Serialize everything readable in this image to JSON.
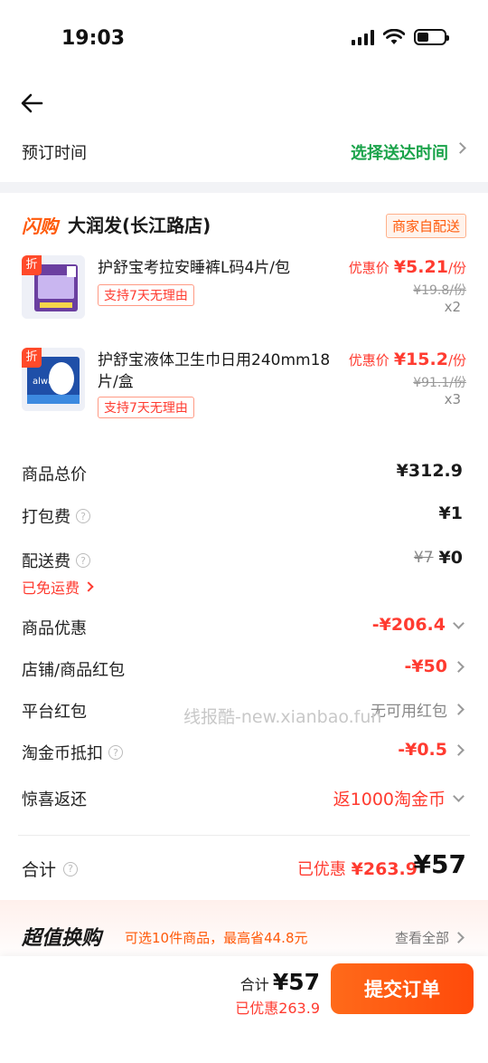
{
  "status_bar": {
    "time": "19:03"
  },
  "header": {
    "order_time_label": "预订时间",
    "order_time_value": "选择送达时间"
  },
  "store": {
    "logo_text": "闪购",
    "name": "大润发(长江路店)",
    "delivery_badge": "商家自配送"
  },
  "products": [
    {
      "discount_tag": "折",
      "name": "护舒宝考拉安睡裤L码4片/包",
      "return_tag": "支持7天无理由",
      "price_label": "优惠价",
      "price": "¥5.21",
      "unit": "/份",
      "original_price": "¥19.8/份",
      "quantity": "x2"
    },
    {
      "discount_tag": "折",
      "name": "护舒宝液体卫生巾日用240mm18片/盒",
      "return_tag": "支持7天无理由",
      "price_label": "优惠价",
      "price": "¥15.2",
      "unit": "/份",
      "original_price": "¥91.1/份",
      "quantity": "x3"
    }
  ],
  "summary": {
    "goods_total_label": "商品总价",
    "goods_total_value": "¥312.9",
    "packing_fee_label": "打包费",
    "packing_fee_value": "¥1",
    "delivery_fee_label": "配送费",
    "delivery_fee_original": "¥7",
    "delivery_fee_value": "¥0",
    "free_shipping_text": "已免运费",
    "goods_discount_label": "商品优惠",
    "goods_discount_value": "-¥206.4",
    "store_coupon_label": "店铺/商品红包",
    "store_coupon_value": "-¥50",
    "platform_coupon_label": "平台红包",
    "platform_coupon_value": "无可用红包",
    "coins_label": "淘金币抵扣",
    "coins_value": "-¥0.5",
    "surprise_label": "惊喜返还",
    "surprise_value": "返1000淘金币"
  },
  "watermark": "线报酷-new.xianbao.fun",
  "total": {
    "label": "合计",
    "discount_text": "已优惠",
    "discount_value": "¥263.9",
    "amount": "¥57"
  },
  "promo": {
    "title": "超值换购",
    "subtitle": "可选10件商品，最高省44.8元",
    "more": "查看全部"
  },
  "bottom_bar": {
    "total_label": "合计",
    "total_amount": "¥57",
    "saved_text": "已优惠263.9",
    "submit_label": "提交订单"
  },
  "colors": {
    "accent_orange": "#ff5a0a",
    "price_red": "#ff3b30",
    "green": "#1aa34a"
  }
}
